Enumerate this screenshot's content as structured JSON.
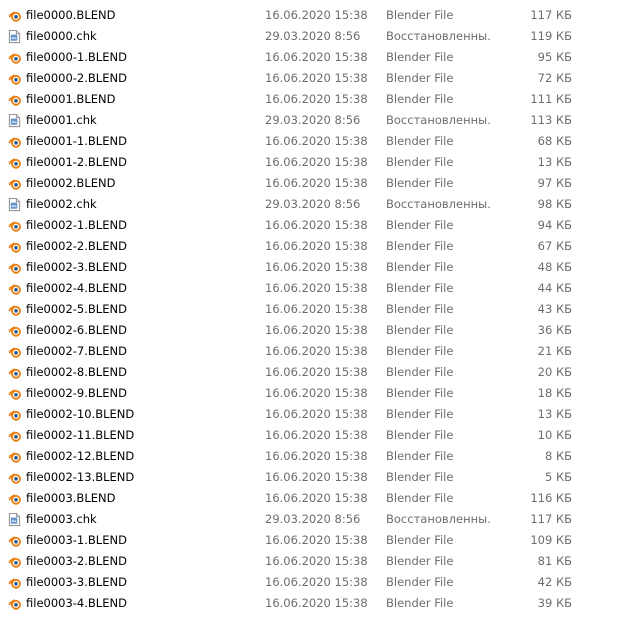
{
  "files": [
    {
      "name": "file0000.BLEND",
      "date": "16.06.2020 15:38",
      "type": "Blender File",
      "size": "117 КБ",
      "icon": "blender-icon"
    },
    {
      "name": "file0000.chk",
      "date": "29.03.2020 8:56",
      "type": "Восстановленны...",
      "size": "119 КБ",
      "icon": "chk-file-icon"
    },
    {
      "name": "file0000-1.BLEND",
      "date": "16.06.2020 15:38",
      "type": "Blender File",
      "size": "95 КБ",
      "icon": "blender-icon"
    },
    {
      "name": "file0000-2.BLEND",
      "date": "16.06.2020 15:38",
      "type": "Blender File",
      "size": "72 КБ",
      "icon": "blender-icon"
    },
    {
      "name": "file0001.BLEND",
      "date": "16.06.2020 15:38",
      "type": "Blender File",
      "size": "111 КБ",
      "icon": "blender-icon"
    },
    {
      "name": "file0001.chk",
      "date": "29.03.2020 8:56",
      "type": "Восстановленны...",
      "size": "113 КБ",
      "icon": "chk-file-icon"
    },
    {
      "name": "file0001-1.BLEND",
      "date": "16.06.2020 15:38",
      "type": "Blender File",
      "size": "68 КБ",
      "icon": "blender-icon"
    },
    {
      "name": "file0001-2.BLEND",
      "date": "16.06.2020 15:38",
      "type": "Blender File",
      "size": "13 КБ",
      "icon": "blender-icon"
    },
    {
      "name": "file0002.BLEND",
      "date": "16.06.2020 15:38",
      "type": "Blender File",
      "size": "97 КБ",
      "icon": "blender-icon"
    },
    {
      "name": "file0002.chk",
      "date": "29.03.2020 8:56",
      "type": "Восстановленны...",
      "size": "98 КБ",
      "icon": "chk-file-icon"
    },
    {
      "name": "file0002-1.BLEND",
      "date": "16.06.2020 15:38",
      "type": "Blender File",
      "size": "94 КБ",
      "icon": "blender-icon"
    },
    {
      "name": "file0002-2.BLEND",
      "date": "16.06.2020 15:38",
      "type": "Blender File",
      "size": "67 КБ",
      "icon": "blender-icon"
    },
    {
      "name": "file0002-3.BLEND",
      "date": "16.06.2020 15:38",
      "type": "Blender File",
      "size": "48 КБ",
      "icon": "blender-icon"
    },
    {
      "name": "file0002-4.BLEND",
      "date": "16.06.2020 15:38",
      "type": "Blender File",
      "size": "44 КБ",
      "icon": "blender-icon"
    },
    {
      "name": "file0002-5.BLEND",
      "date": "16.06.2020 15:38",
      "type": "Blender File",
      "size": "43 КБ",
      "icon": "blender-icon"
    },
    {
      "name": "file0002-6.BLEND",
      "date": "16.06.2020 15:38",
      "type": "Blender File",
      "size": "36 КБ",
      "icon": "blender-icon"
    },
    {
      "name": "file0002-7.BLEND",
      "date": "16.06.2020 15:38",
      "type": "Blender File",
      "size": "21 КБ",
      "icon": "blender-icon"
    },
    {
      "name": "file0002-8.BLEND",
      "date": "16.06.2020 15:38",
      "type": "Blender File",
      "size": "20 КБ",
      "icon": "blender-icon"
    },
    {
      "name": "file0002-9.BLEND",
      "date": "16.06.2020 15:38",
      "type": "Blender File",
      "size": "18 КБ",
      "icon": "blender-icon"
    },
    {
      "name": "file0002-10.BLEND",
      "date": "16.06.2020 15:38",
      "type": "Blender File",
      "size": "13 КБ",
      "icon": "blender-icon"
    },
    {
      "name": "file0002-11.BLEND",
      "date": "16.06.2020 15:38",
      "type": "Blender File",
      "size": "10 КБ",
      "icon": "blender-icon"
    },
    {
      "name": "file0002-12.BLEND",
      "date": "16.06.2020 15:38",
      "type": "Blender File",
      "size": "8 КБ",
      "icon": "blender-icon"
    },
    {
      "name": "file0002-13.BLEND",
      "date": "16.06.2020 15:38",
      "type": "Blender File",
      "size": "5 КБ",
      "icon": "blender-icon"
    },
    {
      "name": "file0003.BLEND",
      "date": "16.06.2020 15:38",
      "type": "Blender File",
      "size": "116 КБ",
      "icon": "blender-icon"
    },
    {
      "name": "file0003.chk",
      "date": "29.03.2020 8:56",
      "type": "Восстановленны...",
      "size": "117 КБ",
      "icon": "chk-file-icon"
    },
    {
      "name": "file0003-1.BLEND",
      "date": "16.06.2020 15:38",
      "type": "Blender File",
      "size": "109 КБ",
      "icon": "blender-icon"
    },
    {
      "name": "file0003-2.BLEND",
      "date": "16.06.2020 15:38",
      "type": "Blender File",
      "size": "81 КБ",
      "icon": "blender-icon"
    },
    {
      "name": "file0003-3.BLEND",
      "date": "16.06.2020 15:38",
      "type": "Blender File",
      "size": "42 КБ",
      "icon": "blender-icon"
    },
    {
      "name": "file0003-4.BLEND",
      "date": "16.06.2020 15:38",
      "type": "Blender File",
      "size": "39 КБ",
      "icon": "blender-icon"
    }
  ],
  "colors": {
    "name_text": "#000000",
    "detail_text": "#6d6d6d",
    "blender_orange": "#e87d0d",
    "blender_blue": "#265787",
    "chk_blue": "#4a7fc1"
  }
}
